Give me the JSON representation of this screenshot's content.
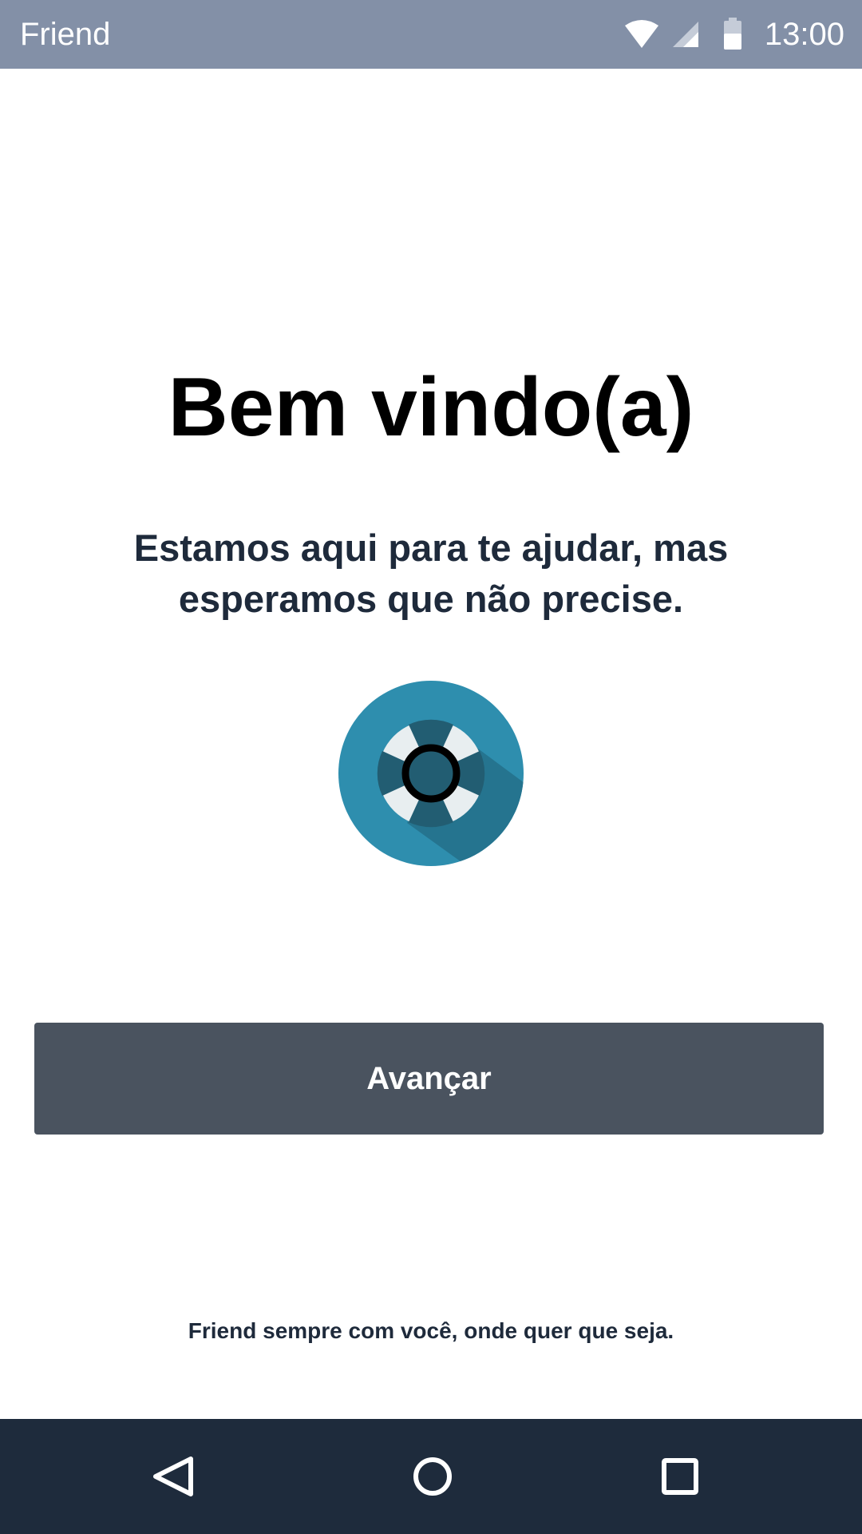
{
  "status_bar": {
    "app_name": "Friend",
    "time": "13:00",
    "icons": [
      "wifi-icon",
      "signal-icon",
      "battery-icon"
    ],
    "background_color": "#8390a7"
  },
  "welcome": {
    "title": "Bem vindo(a)",
    "subtitle": "Estamos aqui para te ajudar, mas esperamos que não precise.",
    "logo_icon": "lifebuoy-icon"
  },
  "actions": {
    "advance_label": "Avançar",
    "advance_color": "#4a535f"
  },
  "footer": {
    "tagline": "Friend sempre com você, onde quer que seja."
  },
  "navigation": {
    "icons": [
      "back-icon",
      "home-icon",
      "recents-icon"
    ],
    "background_color": "#1e2b3c"
  },
  "colors": {
    "brand_blue": "#2e8eae",
    "brand_dark_blue": "#25748f",
    "text_dark": "#1e2a3b"
  }
}
